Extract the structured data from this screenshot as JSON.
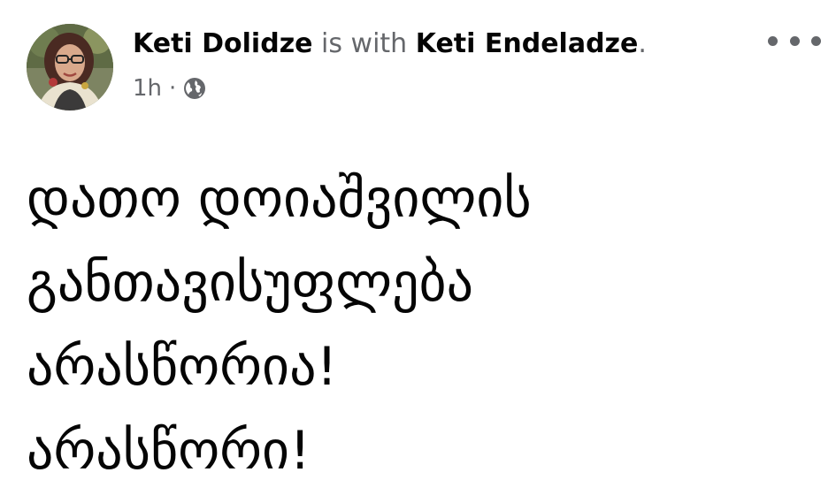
{
  "post": {
    "author": "Keti Dolidze",
    "with_text": " is with ",
    "tagged": "Keti Endeladze",
    "tagged_suffix": ".",
    "time": "1h",
    "separator": "·",
    "audience_icon": "globe-icon",
    "more_icon": "more-horizontal-icon",
    "body_lines": [
      "დათო დოიაშვილის",
      "განთავისუფლება",
      "არასწორია!",
      "არასწორი!"
    ]
  },
  "colors": {
    "name": "#050505",
    "secondary": "#65676b",
    "background": "#ffffff"
  }
}
